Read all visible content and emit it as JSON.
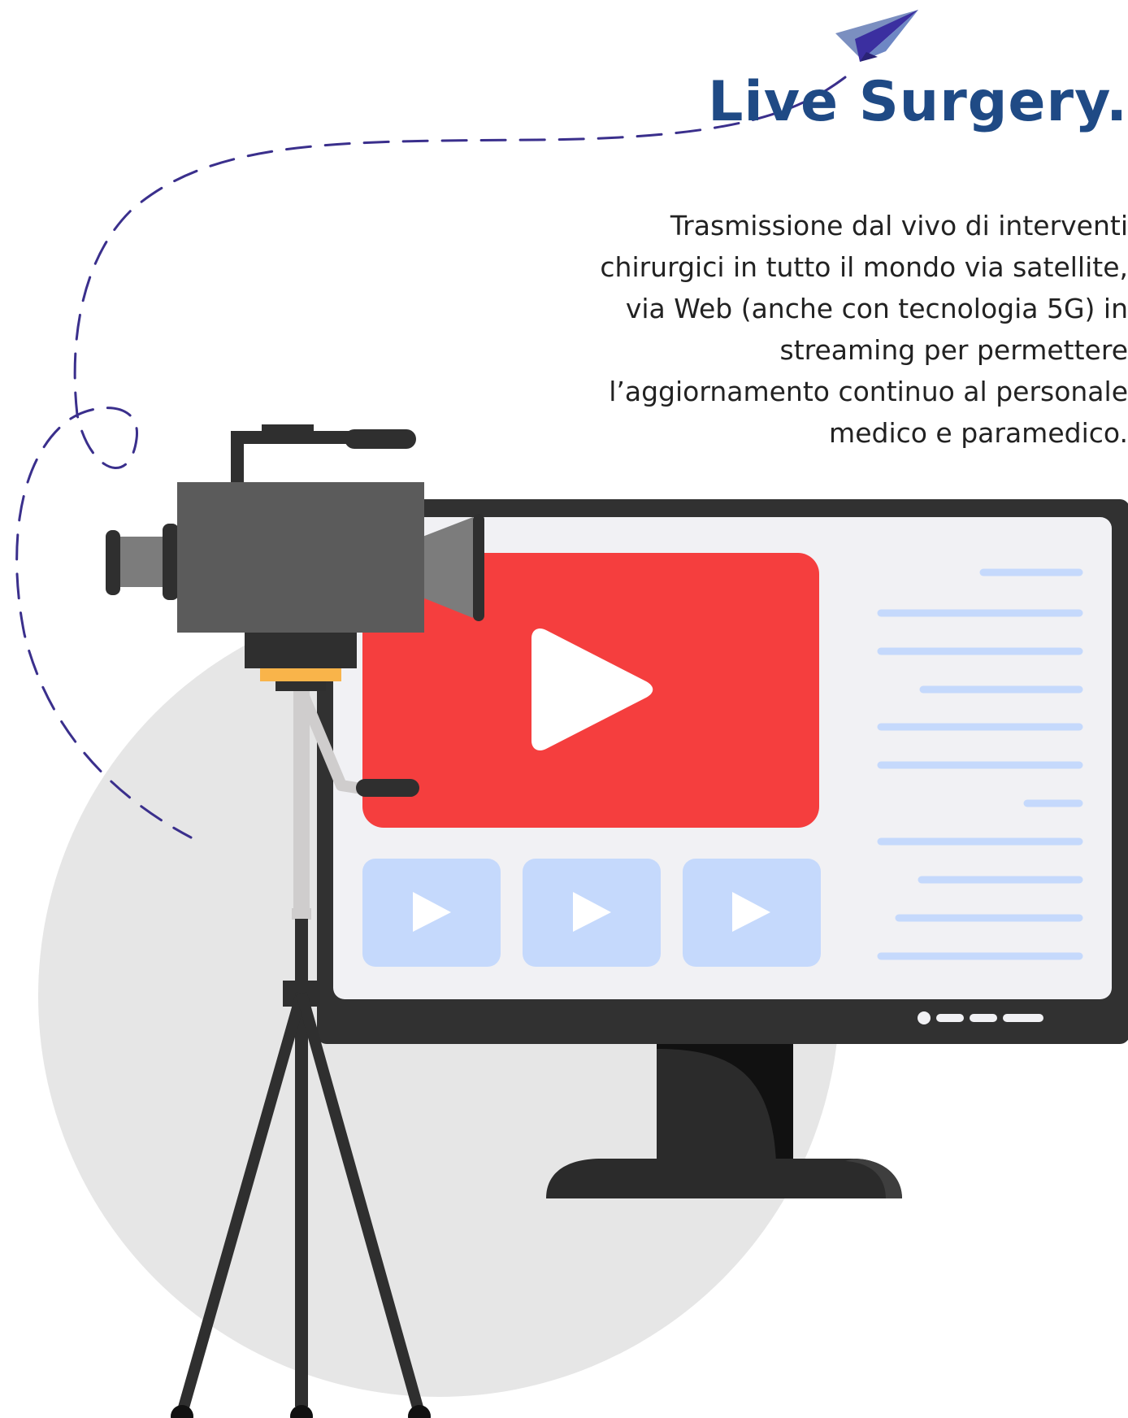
{
  "header": {
    "title": "Live Surgery."
  },
  "body": {
    "description": "Trasmissione dal vivo di interventi chirurgici in tutto il mondo via satellite, via Web (anche con tecnologia 5G) in streaming per permettere l’aggiornamento continuo al personale medico e paramedico."
  },
  "colors": {
    "title": "#1f4a85",
    "accent_dash": "#3a2f8c",
    "video_player": "#f53e3e",
    "thumbnail": "#c5d9fc",
    "text_line": "#c5d9fc",
    "monitor_frame": "#313131",
    "camera_body": "#5b5b5b",
    "background_circle": "#e6e6e6"
  },
  "icons": [
    "paper-plane-icon",
    "play-icon",
    "video-camera-icon",
    "tripod-icon",
    "monitor-icon"
  ]
}
